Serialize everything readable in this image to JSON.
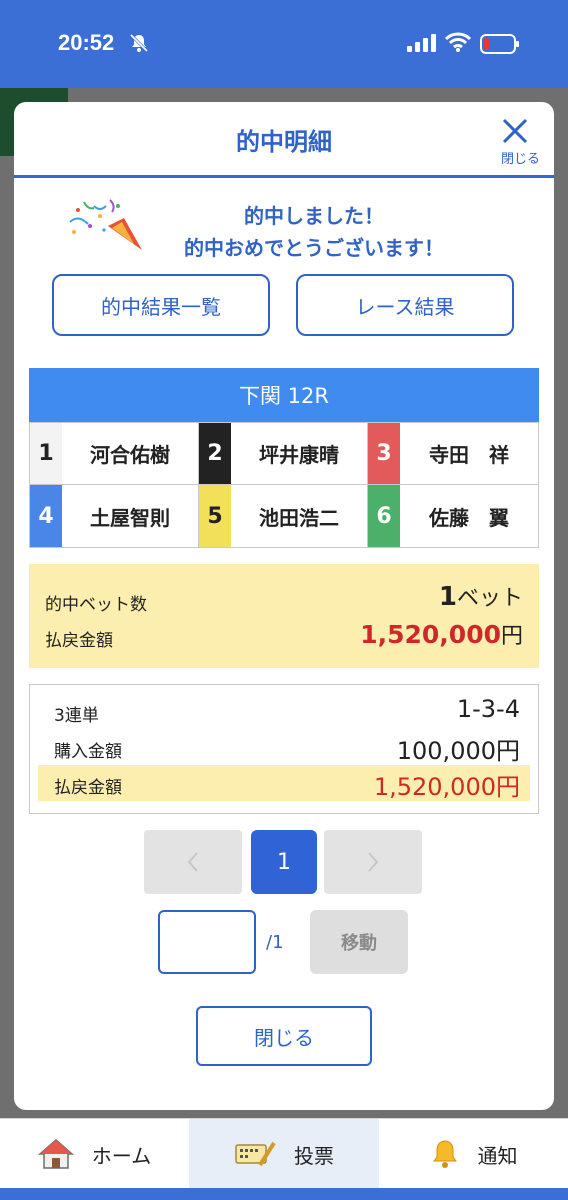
{
  "status": {
    "time": "20:52"
  },
  "modal": {
    "title": "的中明細",
    "close_label": "閉じる",
    "congrats_line1": "的中しました！",
    "congrats_line2": "的中おめでとうございます！",
    "hit_list_button": "的中結果一覧",
    "race_result_button": "レース結果",
    "race_name": "下関 12R",
    "racers": [
      {
        "num": "1",
        "name": "河合佑樹",
        "bg": "#f3f3f3",
        "fg": "#222222"
      },
      {
        "num": "2",
        "name": "坪井康晴",
        "bg": "#222222",
        "fg": "#ffffff"
      },
      {
        "num": "3",
        "name": "寺田　祥",
        "bg": "#e35a5a",
        "fg": "#ffffff"
      },
      {
        "num": "4",
        "name": "土屋智則",
        "bg": "#4a86e8",
        "fg": "#ffffff"
      },
      {
        "num": "5",
        "name": "池田浩二",
        "bg": "#f3e05a",
        "fg": "#222222"
      },
      {
        "num": "6",
        "name": "佐藤　翼",
        "bg": "#4caf6a",
        "fg": "#ffffff"
      }
    ],
    "summary": {
      "bets_label": "的中ベット数",
      "bets_count": "1",
      "bets_unit": "ベット",
      "payout_label": "払戻金額",
      "payout_value": "1,520,000",
      "payout_unit": "円"
    },
    "detail": {
      "bet_type": "3連単",
      "combination": "1-3-4",
      "purchase_label": "購入金額",
      "purchase_value": "100,000円",
      "payout_label": "払戻金額",
      "payout_value": "1,520,000円"
    },
    "pager": {
      "current": "1",
      "total": "/1",
      "input_value": "",
      "move_label": "移動"
    },
    "bottom_close": "閉じる"
  },
  "bottom_nav": {
    "home": "ホーム",
    "vote": "投票",
    "notify": "通知"
  },
  "colors": {
    "accent": "#2f63c6",
    "header_blue": "#3b6fd6",
    "payout_red": "#d0282a",
    "highlight": "#fbeeaf"
  }
}
